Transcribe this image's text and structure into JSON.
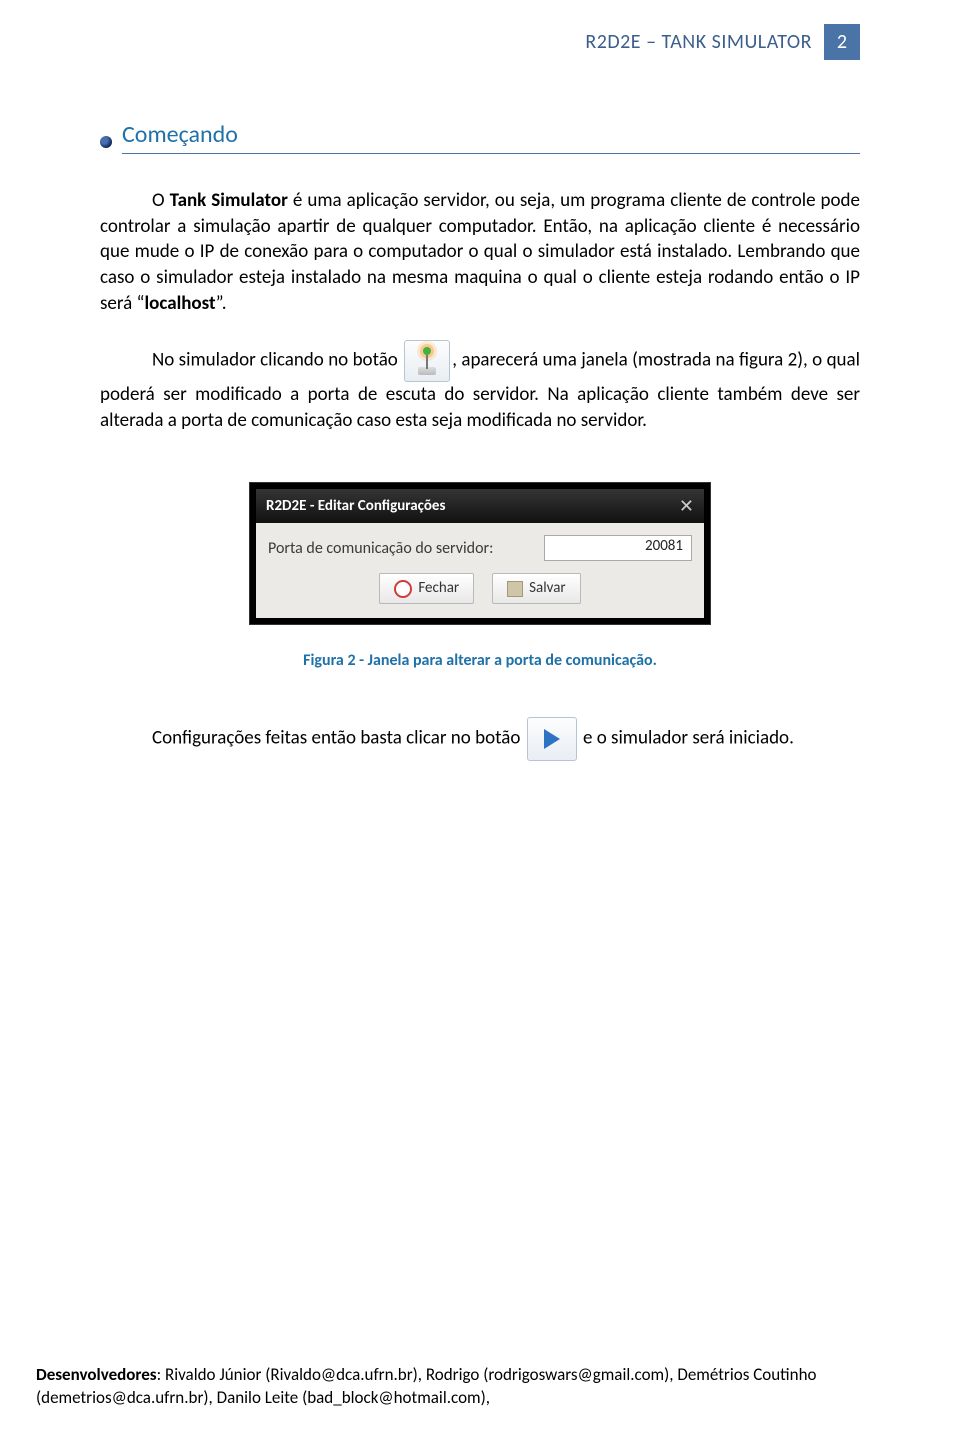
{
  "header": {
    "title": "R2D2E – TANK SIMULATOR",
    "page_number": "2"
  },
  "section": {
    "title": "Começando"
  },
  "paragraphs": {
    "p1_a": "O ",
    "p1_b": "Tank Simulator",
    "p1_c": " é uma aplicação servidor, ou seja, um programa cliente de controle pode controlar a simulação apartir de qualquer computador. Então, na aplicação cliente é necessário que mude o IP de conexão para o computador o qual o simulador está instalado. Lembrando que caso o simulador esteja instalado na mesma maquina o qual o cliente esteja rodando então o IP será “",
    "p1_d": "localhost",
    "p1_e": "”.",
    "p2_a": "No simulador clicando no botão ",
    "p2_b": ", aparecerá uma janela (mostrada na figura 2), o qual poderá ser modificado a porta de escuta do servidor. Na aplicação cliente também deve ser alterada a porta de comunicação caso esta seja modificada no servidor.",
    "p3_a": "Configurações feitas então basta clicar no botão ",
    "p3_b": " e o simulador será iniciado."
  },
  "dialog": {
    "title": "R2D2E - Editar Configurações",
    "field_label": "Porta de comunicação do servidor:",
    "field_value": "20081",
    "btn_close": "Fechar",
    "btn_save": "Salvar"
  },
  "caption": "Figura 2 - Janela para alterar a porta de comunicação.",
  "footer": {
    "label": "Desenvolvedores",
    "rest": ": Rivaldo Júnior (Rivaldo@dca.ufrn.br), Rodrigo (rodrigoswars@gmail.com), Demétrios Coutinho (demetrios@dca.ufrn.br), Danilo Leite (bad_block@hotmail.com),"
  }
}
